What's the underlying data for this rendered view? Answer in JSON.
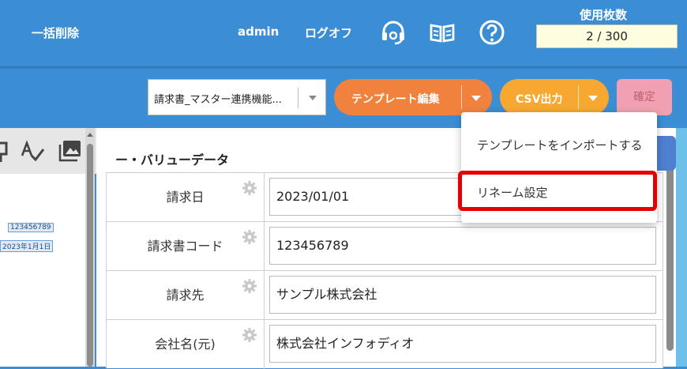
{
  "header": {
    "bulk_delete": "一括削除",
    "user": "admin",
    "logoff": "ログオフ",
    "icons": [
      "support-headset-icon",
      "manual-book-icon",
      "help-icon"
    ],
    "usage_label": "使用枚数",
    "usage_value": "2 / 300"
  },
  "toolbar": {
    "template_select": "請求書_マスター連携機能...",
    "template_edit": "テンプレート編集",
    "csv_output": "CSV出力",
    "confirm": "確定"
  },
  "dropdown_menu": {
    "items": [
      "テンプレートをインポートする",
      "リネーム設定"
    ],
    "highlighted": "リネーム設定"
  },
  "left_panel": {
    "stamps": [
      "123456789",
      "2023年1月1日"
    ]
  },
  "main": {
    "section_title": "ー・バリューデータ",
    "fields": [
      {
        "name": "請求日",
        "value": "2023/01/01"
      },
      {
        "name": "請求書コード",
        "value": "123456789"
      },
      {
        "name": "請求先",
        "value": "サンプル株式会社"
      },
      {
        "name": "会社名(元)",
        "value": "株式会社インフォディオ"
      }
    ]
  },
  "colors": {
    "header_bg": "#3b8ed3",
    "template_button": "#f0823e",
    "csv_button": "#f7a830",
    "confirm_button": "#f0a0b0",
    "highlight_border": "#e40000"
  }
}
